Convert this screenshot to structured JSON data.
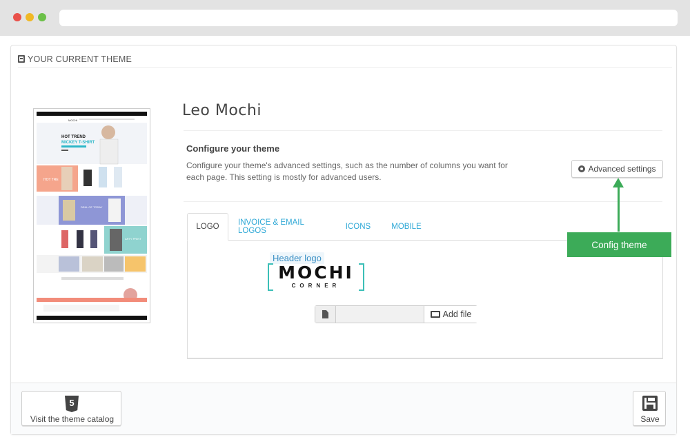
{
  "panel": {
    "heading": "YOUR CURRENT THEME"
  },
  "theme": {
    "name": "Leo  Mochi",
    "thumbnail": {
      "site_label": "MOCHI",
      "hero_line1": "HOT TREND",
      "hero_line2": "MICKEY T-SHIRT",
      "banner1": "HOT TRE",
      "banner2": "DEAL OF TODAY",
      "banner3": "ARTY PRINT"
    }
  },
  "configure": {
    "title": "Configure your theme",
    "description": "Configure your theme's advanced settings, such as the number of columns you want for each page. This setting is mostly for advanced users.",
    "advanced_button": "Advanced settings"
  },
  "tabs": [
    {
      "label": "LOGO"
    },
    {
      "label": "INVOICE & EMAIL LOGOS"
    },
    {
      "label": "ICONS"
    },
    {
      "label": "MOBILE"
    }
  ],
  "logo_tab": {
    "header_logo_label": "Header logo",
    "logo_main": "MOCHI",
    "logo_sub": "CORNER",
    "add_file_button": "Add file"
  },
  "callout": {
    "label": "Config theme"
  },
  "footer": {
    "catalog_icon": "5",
    "catalog_button": "Visit the theme catalog",
    "save_button": "Save"
  },
  "icons": {
    "heading": "html5-icon",
    "advanced": "gear-icon",
    "file": "file-icon",
    "add_file": "folder-open-icon",
    "catalog": "html5-icon",
    "save": "floppy-disk-icon"
  },
  "colors": {
    "accent_link": "#2ea8d6",
    "callout_green": "#3cab58",
    "logo_bracket": "#3bbfb7"
  }
}
